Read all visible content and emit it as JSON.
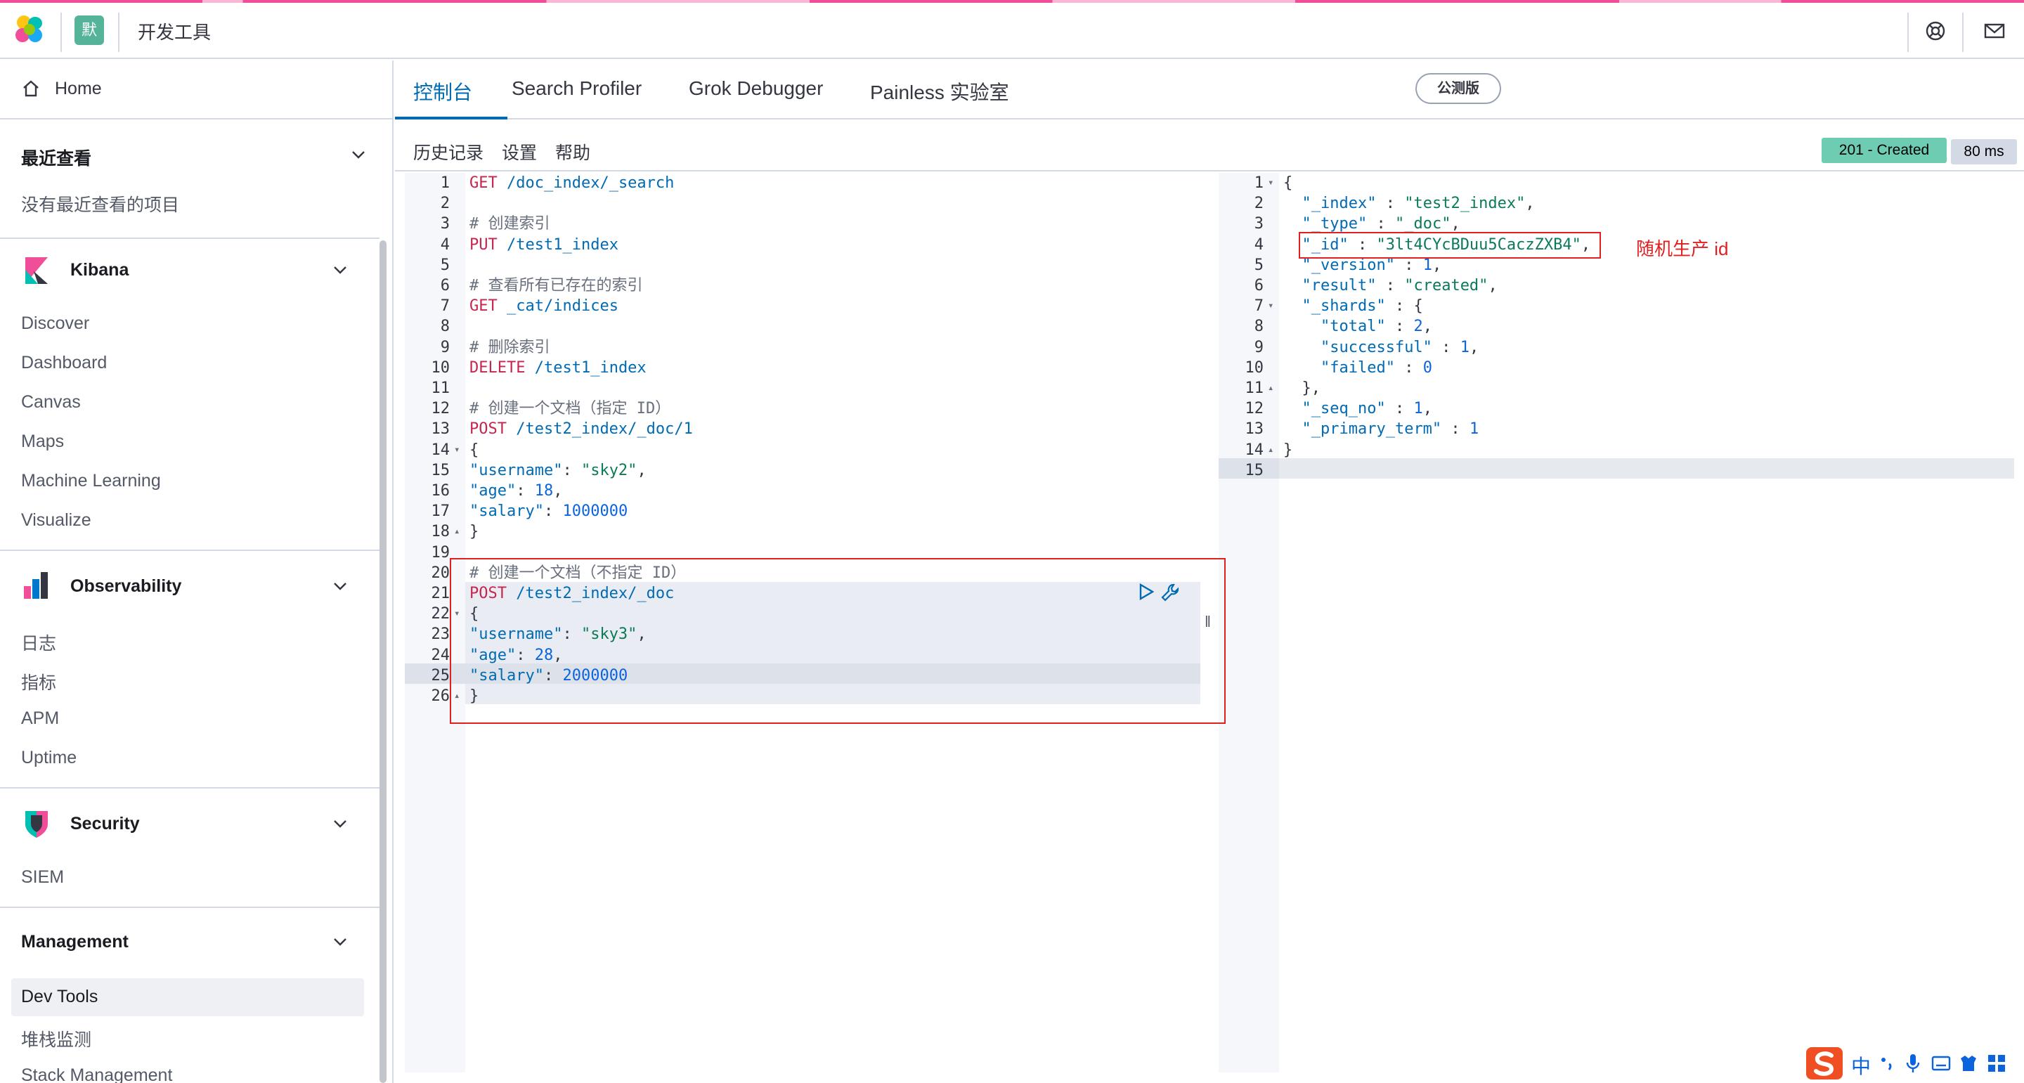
{
  "header": {
    "space_initial": "默",
    "title": "开发工具"
  },
  "sidebar": {
    "home": "Home",
    "recent": {
      "title": "最近查看",
      "empty": "没有最近查看的项目"
    },
    "groups": [
      {
        "title": "Kibana",
        "items": [
          "Discover",
          "Dashboard",
          "Canvas",
          "Maps",
          "Machine Learning",
          "Visualize"
        ]
      },
      {
        "title": "Observability",
        "items": [
          "日志",
          "指标",
          "APM",
          "Uptime"
        ]
      },
      {
        "title": "Security",
        "items": [
          "SIEM"
        ]
      },
      {
        "title": "Management",
        "items": [
          "Dev Tools",
          "堆栈监测",
          "Stack Management"
        ]
      }
    ]
  },
  "tabs": [
    {
      "label": "控制台",
      "active": true
    },
    {
      "label": "Search Profiler"
    },
    {
      "label": "Grok Debugger"
    },
    {
      "label": "Painless 实验室"
    }
  ],
  "beta_badge": "公测版",
  "toolbar": {
    "links": [
      "历史记录",
      "设置",
      "帮助"
    ],
    "status": "201 - Created",
    "time": "80 ms"
  },
  "request_lines": [
    "GET /doc_index/_search",
    "",
    "# 创建索引",
    "PUT /test1_index",
    "",
    "# 查看所有已存在的索引",
    "GET _cat/indices",
    "",
    "# 删除索引",
    "DELETE /test1_index",
    "",
    "# 创建一个文档（指定 ID）",
    "POST /test2_index/_doc/1",
    "{",
    "\"username\": \"sky2\",",
    "\"age\": 18,",
    "\"salary\": 1000000",
    "}",
    "",
    "# 创建一个文档（不指定 ID）",
    "POST /test2_index/_doc",
    "{",
    "\"username\": \"sky3\",",
    "\"age\": 28,",
    "\"salary\": 2000000",
    "}"
  ],
  "response_lines": [
    "{",
    "  \"_index\" : \"test2_index\",",
    "  \"_type\" : \"_doc\",",
    "  \"_id\" : \"3lt4CYcBDuu5CaczZXB4\",",
    "  \"_version\" : 1,",
    "  \"result\" : \"created\",",
    "  \"_shards\" : {",
    "    \"total\" : 2,",
    "    \"successful\" : 1,",
    "    \"failed\" : 0",
    "  },",
    "  \"_seq_no\" : 1,",
    "  \"_primary_term\" : 1",
    "}",
    ""
  ],
  "annotation": "随机生产 id",
  "ime": {
    "lang": "中"
  },
  "colors": {
    "accent": "#006bb4",
    "success": "#6dccb1",
    "annotation": "#e02020"
  }
}
